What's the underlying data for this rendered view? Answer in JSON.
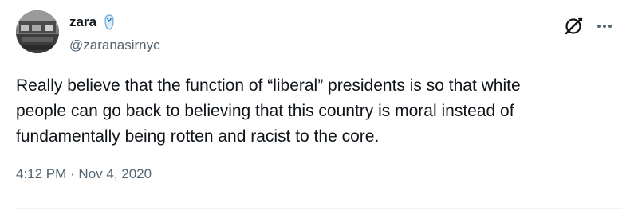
{
  "author": {
    "display_name": "zara",
    "handle": "@zaranasirnyc",
    "badge_icon": "flip-flop-icon"
  },
  "tweet": {
    "text": "Really believe that the function of “liberal” presidents is so that white\npeople can go back to believing that this country is moral instead of\nfundamentally being rotten and racist to the core.",
    "timestamp": "4:12 PM · Nov 4, 2020"
  },
  "header_icons": {
    "grok": "grok-icon",
    "more": "more-icon"
  },
  "colors": {
    "text_primary": "#0f1419",
    "text_secondary": "#536471",
    "badge_blue": "#6aa6d8"
  }
}
